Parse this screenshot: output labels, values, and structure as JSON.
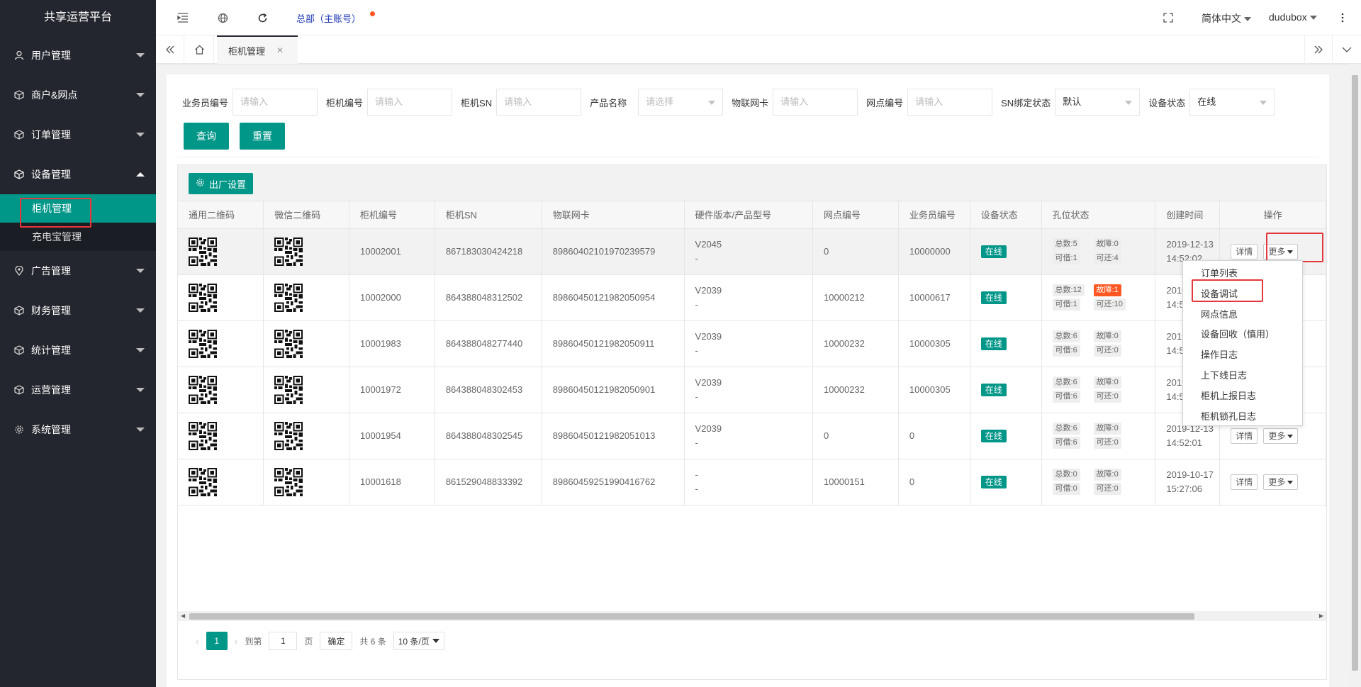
{
  "app_title": "共享运营平台",
  "sidebar": {
    "items": [
      {
        "label": "用户管理",
        "icon": "user-icon"
      },
      {
        "label": "商户&网点",
        "icon": "cube-icon"
      },
      {
        "label": "订单管理",
        "icon": "cube-icon"
      },
      {
        "label": "设备管理",
        "icon": "cube-icon"
      },
      {
        "label": "广告管理",
        "icon": "location-icon"
      },
      {
        "label": "财务管理",
        "icon": "cube-icon"
      },
      {
        "label": "统计管理",
        "icon": "cube-icon"
      },
      {
        "label": "运营管理",
        "icon": "cube-icon"
      },
      {
        "label": "系统管理",
        "icon": "gear-icon"
      }
    ],
    "sub_items": [
      "柜机管理",
      "充电宝管理"
    ]
  },
  "header": {
    "org": "总部（主账号）",
    "language": "简体中文",
    "user": "dudubox"
  },
  "tabs": {
    "active": "柜机管理"
  },
  "filters": {
    "salesman_label": "业务员编号",
    "salesman_placeholder": "请输入",
    "cabinet_no_label": "柜机编号",
    "cabinet_no_placeholder": "请输入",
    "cabinet_sn_label": "柜机SN",
    "cabinet_sn_placeholder": "请输入",
    "product_label": "产品名称",
    "product_placeholder": "请选择",
    "iot_label": "物联网卡",
    "iot_placeholder": "请输入",
    "outlet_label": "网点编号",
    "outlet_placeholder": "请输入",
    "sn_bind_label": "SN绑定状态",
    "sn_bind_value": "默认",
    "device_status_label": "设备状态",
    "device_status_value": "在线",
    "query_btn": "查询",
    "reset_btn": "重置"
  },
  "toolbar": {
    "factory_btn": "出厂设置"
  },
  "table": {
    "headers": [
      "通用二维码",
      "微信二维码",
      "柜机编号",
      "柜机SN",
      "物联网卡",
      "硬件版本/产品型号",
      "网点编号",
      "业务员编号",
      "设备状态",
      "孔位状态",
      "创建时间",
      "操作"
    ],
    "rows": [
      {
        "cab_no": "10002001",
        "sn": "867183030424218",
        "iot": "89860402101970239579",
        "hw": "V2045",
        "model": "-",
        "outlet": "0",
        "salesman": "10000000",
        "status": "在线",
        "total": "总数:5",
        "fault": "故障:0",
        "borrow": "可借:1",
        "return": "可还:4",
        "date": "2019-12-13",
        "time": "14:52:02"
      },
      {
        "cab_no": "10002000",
        "sn": "864388048312502",
        "iot": "89860450121982050954",
        "hw": "V2039",
        "model": "-",
        "outlet": "10000212",
        "salesman": "10000617",
        "status": "在线",
        "total": "总数:12",
        "fault": "故障:1",
        "borrow": "可借:1",
        "return": "可还:10",
        "date": "2019-12-13",
        "time": "14:52:02"
      },
      {
        "cab_no": "10001983",
        "sn": "864388048277440",
        "iot": "89860450121982050911",
        "hw": "V2039",
        "model": "-",
        "outlet": "10000232",
        "salesman": "10000305",
        "status": "在线",
        "total": "总数:6",
        "fault": "故障:0",
        "borrow": "可借:6",
        "return": "可还:0",
        "date": "2019-12-13",
        "time": "14:52:02"
      },
      {
        "cab_no": "10001972",
        "sn": "864388048302453",
        "iot": "89860450121982050901",
        "hw": "V2039",
        "model": "-",
        "outlet": "10000232",
        "salesman": "10000305",
        "status": "在线",
        "total": "总数:6",
        "fault": "故障:0",
        "borrow": "可借:6",
        "return": "可还:0",
        "date": "2019-12-13",
        "time": "14:52:02"
      },
      {
        "cab_no": "10001954",
        "sn": "864388048302545",
        "iot": "89860450121982051013",
        "hw": "V2039",
        "model": "-",
        "outlet": "0",
        "salesman": "0",
        "status": "在线",
        "total": "总数:6",
        "fault": "故障:0",
        "borrow": "可借:6",
        "return": "可还:0",
        "date": "2019-12-13",
        "time": "14:52:01"
      },
      {
        "cab_no": "10001618",
        "sn": "861529048833392",
        "iot": "89860459251990416762",
        "hw": "-",
        "model": "-",
        "outlet": "10000151",
        "salesman": "0",
        "status": "在线",
        "total": "总数:0",
        "fault": "故障:0",
        "borrow": "可借:0",
        "return": "可还:0",
        "date": "2019-10-17",
        "time": "15:27:06"
      }
    ],
    "detail_btn": "详情",
    "more_btn": "更多"
  },
  "dropdown": {
    "items": [
      "订单列表",
      "设备调试",
      "网点信息",
      "设备回收（慎用）",
      "操作日志",
      "上下线日志",
      "柜机上报日志",
      "柜机锁孔日志"
    ]
  },
  "pager": {
    "current": "1",
    "goto_label": "到第",
    "goto_value": "1",
    "page_label": "页",
    "confirm": "确定",
    "total": "共 6 条",
    "page_size": "10 条/页"
  },
  "colors": {
    "sidebar_bg": "#23262e",
    "accent": "#009688",
    "fault": "#ff5722",
    "highlight_box": "#e4393c",
    "org_text": "#1e38b5"
  }
}
